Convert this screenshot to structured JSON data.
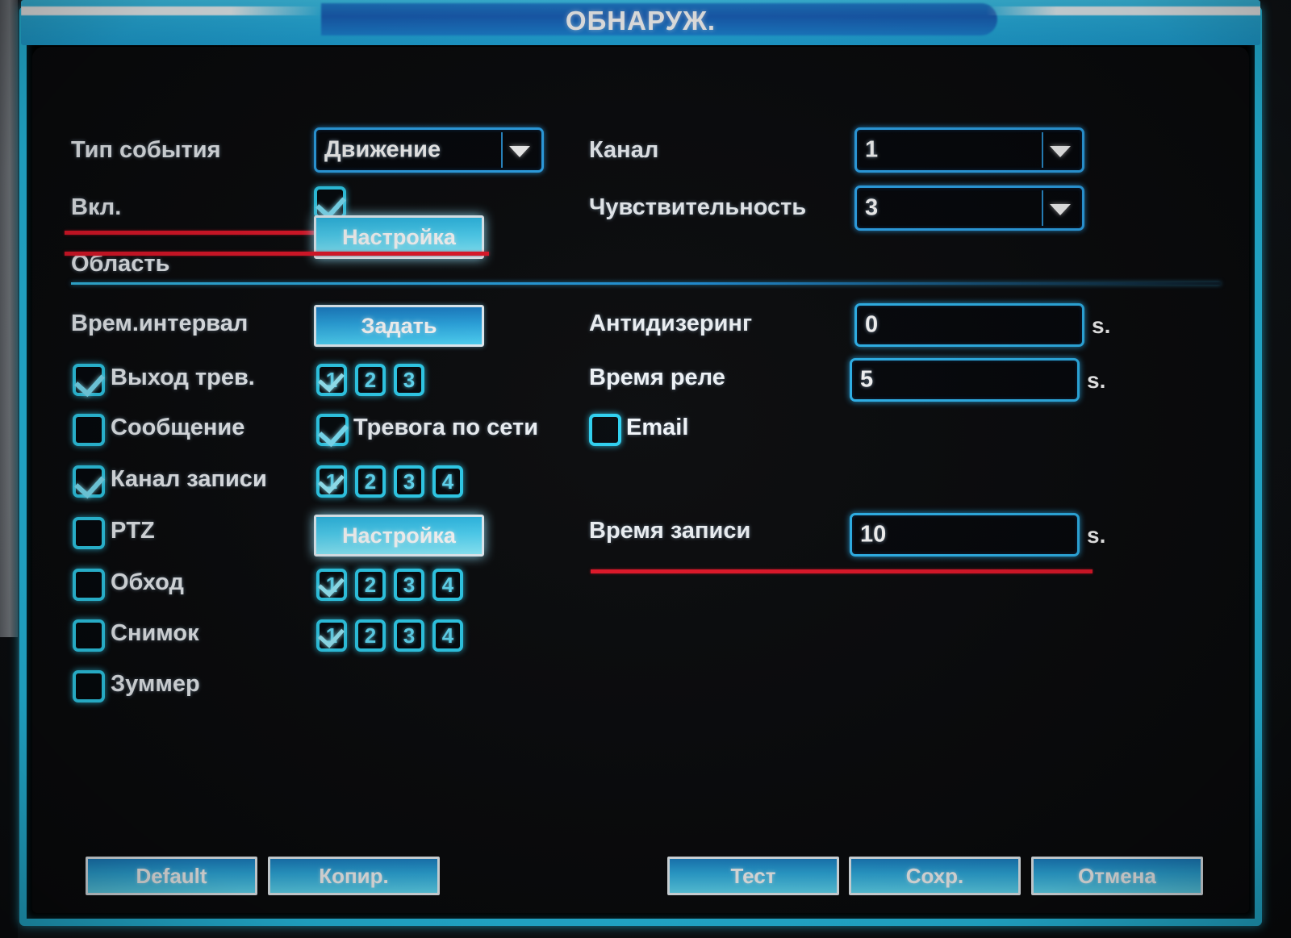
{
  "window": {
    "title": "ОБНАРУЖ."
  },
  "form": {
    "event_type": {
      "label": "Тип события",
      "value": "Движение"
    },
    "enable": {
      "label": "Вкл.",
      "checked": true
    },
    "region": {
      "label": "Область",
      "button": "Настройка"
    },
    "channel": {
      "label": "Канал",
      "value": "1"
    },
    "sensitivity": {
      "label": "Чувствительность",
      "value": "3"
    },
    "period": {
      "label": "Врем.интервал",
      "button": "Задать"
    },
    "antidither": {
      "label": "Антидизеринг",
      "value": "0",
      "unit": "s."
    },
    "relay_time": {
      "label": "Время реле",
      "value": "5",
      "unit": "s."
    },
    "record_delay": {
      "label": "Время записи",
      "value": "10",
      "unit": "s."
    },
    "alarm_out": {
      "label": "Выход трев.",
      "checked": true,
      "channels": [
        "1",
        "2",
        "3"
      ],
      "selected": [
        "1"
      ]
    },
    "message": {
      "label": "Сообщение",
      "checked": false
    },
    "net_alarm": {
      "label": "Тревога по сети",
      "checked": true
    },
    "email": {
      "label": "Email",
      "checked": false
    },
    "record_ch": {
      "label": "Канал записи",
      "checked": true,
      "channels": [
        "1",
        "2",
        "3",
        "4"
      ],
      "selected": [
        "1"
      ]
    },
    "ptz": {
      "label": "PTZ",
      "checked": false,
      "button": "Настройка"
    },
    "tour": {
      "label": "Обход",
      "checked": false,
      "channels": [
        "1",
        "2",
        "3",
        "4"
      ],
      "selected": [
        "1"
      ]
    },
    "snapshot": {
      "label": "Снимок",
      "checked": false,
      "channels": [
        "1",
        "2",
        "3",
        "4"
      ],
      "selected": [
        "1"
      ]
    },
    "buzzer": {
      "label": "Зуммер",
      "checked": false
    }
  },
  "footer": {
    "default": "Default",
    "copy": "Копир.",
    "test": "Тест",
    "save": "Сохр.",
    "cancel": "Отмена"
  },
  "colors": {
    "accent": "#2ea8f0",
    "glow": "#2fd2f2",
    "title_bar": "#29b6e8",
    "highlight_red": "#e8172a",
    "panel_bg": "#0a0b0d",
    "text": "#f2f6fa"
  }
}
